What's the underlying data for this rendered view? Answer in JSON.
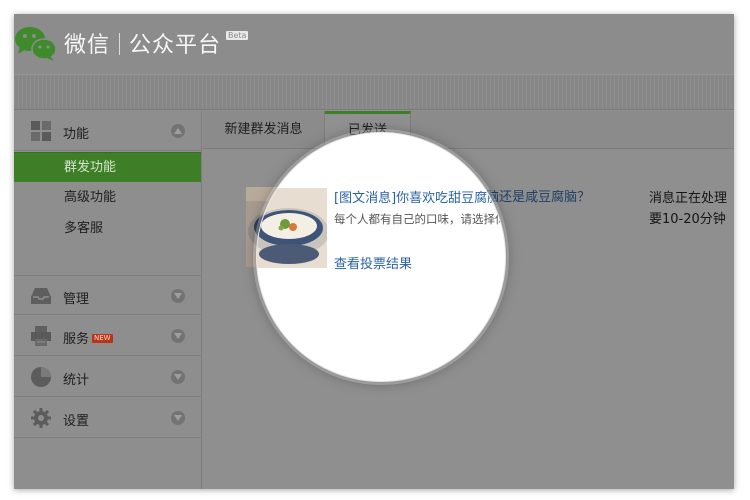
{
  "header": {
    "brand_name": "微信",
    "brand_product": "公众平台",
    "beta_badge": "Beta"
  },
  "sidebar": {
    "sections": [
      {
        "label": "功能",
        "icon": "grid-icon",
        "expanded": true
      },
      {
        "label": "管理",
        "icon": "inbox-icon",
        "expanded": false
      },
      {
        "label": "服务",
        "icon": "printer-icon",
        "badge": "NEW",
        "expanded": false
      },
      {
        "label": "统计",
        "icon": "pie-chart-icon",
        "expanded": false
      },
      {
        "label": "设置",
        "icon": "gear-icon",
        "expanded": false
      }
    ],
    "function_items": [
      {
        "label": "群发功能",
        "active": true
      },
      {
        "label": "高级功能",
        "active": false
      },
      {
        "label": "多客服",
        "active": false
      }
    ]
  },
  "tabs": [
    {
      "label": "新建群发消息",
      "active": false
    },
    {
      "label": "已发送",
      "active": true
    }
  ],
  "message": {
    "title": "[图文消息]你喜欢吃甜豆腐脑还是咸豆腐脑？",
    "description": "每个人都有自己的口味，请选择你的口味吧~",
    "vote_link": "查看投票结果",
    "status_line1": "消息正在处理",
    "status_line2": "要10-20分钟"
  },
  "colors": {
    "accent_green": "#3d7e26",
    "link_blue": "#2a62a8",
    "overlay_gray": "#8f8f8f"
  }
}
